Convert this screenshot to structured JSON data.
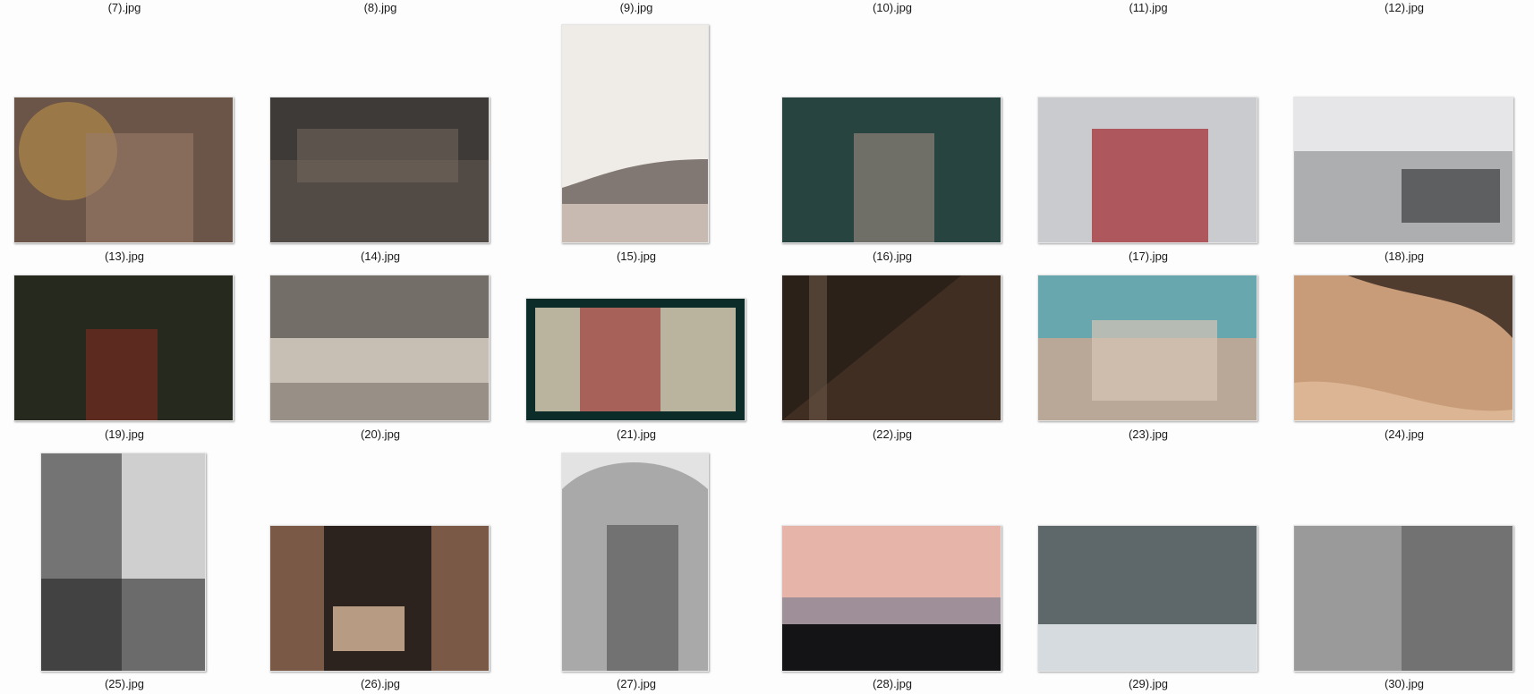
{
  "top_labels": [
    "(7).jpg",
    "(8).jpg",
    "(9).jpg",
    "(10).jpg",
    "(11).jpg",
    "(12).jpg"
  ],
  "files": [
    {
      "label": "(13).jpg",
      "colors": [
        "#6b5548",
        "#d4a44a",
        "#9a7b6a"
      ]
    },
    {
      "label": "(14).jpg",
      "colors": [
        "#3e3a37",
        "#5b514b",
        "#7a6b62"
      ]
    },
    {
      "label": "(15).jpg",
      "colors": [
        "#efebe6",
        "#6e645e",
        "#b9a59a"
      ]
    },
    {
      "label": "(16).jpg",
      "colors": [
        "#1d3a35",
        "#2f4c49",
        "#8a7d74"
      ]
    },
    {
      "label": "(17).jpg",
      "colors": [
        "#e7e8ea",
        "#a6a9ad",
        "#a2262f"
      ]
    },
    {
      "label": "(18).jpg",
      "colors": [
        "#e6e6e8",
        "#7d7f82",
        "#3b3d40"
      ]
    },
    {
      "label": "(19).jpg",
      "colors": [
        "#1f2117",
        "#2d3223",
        "#6a2a20"
      ]
    },
    {
      "label": "(20).jpg",
      "colors": [
        "#c8bfb4",
        "#4f4b46",
        "#2b2622"
      ]
    },
    {
      "label": "(21).jpg",
      "colors": [
        "#0c2c2a",
        "#9b2a2a",
        "#d9cbb2"
      ]
    },
    {
      "label": "(22).jpg",
      "colors": [
        "#2b2119",
        "#4a3528",
        "#6b5748"
      ]
    },
    {
      "label": "(23).jpg",
      "colors": [
        "#5aa7b1",
        "#d7c5b7",
        "#b9a898"
      ]
    },
    {
      "label": "(24).jpg",
      "colors": [
        "#c89c78",
        "#3b2a22",
        "#e2c0a0"
      ]
    },
    {
      "label": "(25).jpg",
      "colors": [
        "#cfcfcf",
        "#4d4d4d",
        "#1a1a1a"
      ]
    },
    {
      "label": "(26).jpg",
      "colors": [
        "#7a5a47",
        "#1f1a18",
        "#e6c4a4"
      ]
    },
    {
      "label": "(27).jpg",
      "colors": [
        "#e3e3e3",
        "#7a7a7a",
        "#2e2e2e"
      ]
    },
    {
      "label": "(28).jpg",
      "colors": [
        "#e7b4a9",
        "#7f7f93",
        "#141416"
      ]
    },
    {
      "label": "(29).jpg",
      "colors": [
        "#eaeef2",
        "#2f3b3c",
        "#9aa3a6"
      ]
    },
    {
      "label": "(30).jpg",
      "colors": [
        "#dcdcdc",
        "#4a4a4a",
        "#1b1b1b"
      ]
    }
  ]
}
